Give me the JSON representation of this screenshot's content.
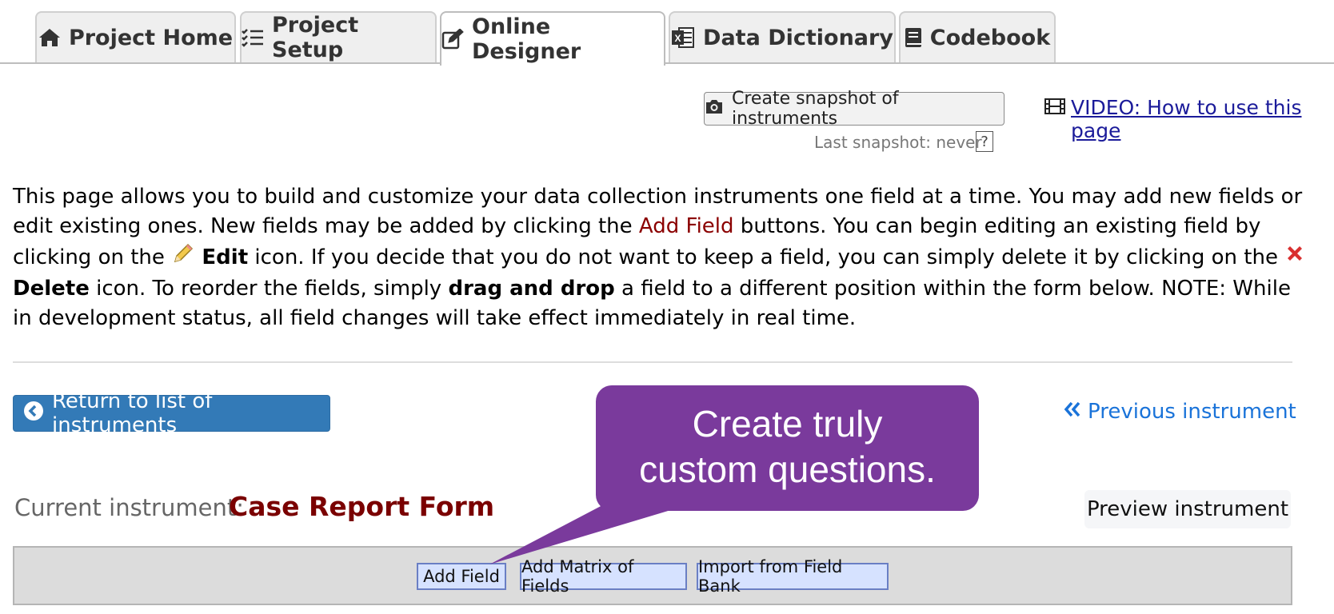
{
  "tabs": [
    {
      "label": "Project Home",
      "icon": "home-icon"
    },
    {
      "label": "Project Setup",
      "icon": "checklist-icon"
    },
    {
      "label": "Online Designer",
      "icon": "edit-icon",
      "active": true
    },
    {
      "label": "Data Dictionary",
      "icon": "excel-icon"
    },
    {
      "label": "Codebook",
      "icon": "book-icon"
    }
  ],
  "snapshot": {
    "button_label": "Create snapshot of instruments",
    "last_snapshot": "Last snapshot: never",
    "help": "?"
  },
  "video_link": "VIDEO: How to use this page",
  "instructions": {
    "p1": "This page allows you to build and customize your data collection instruments one field at a time. You may add new fields or edit existing ones. New fields may be added by clicking the ",
    "add_field": "Add Field",
    "p2": " buttons. You can begin editing an existing field by clicking on the ",
    "edit": "Edit",
    "p3": " icon. If you decide that you do not want to keep a field, you can simply delete it by clicking on the ",
    "delete": "Delete",
    "p4": " icon. To reorder the fields, simply ",
    "drag": "drag and drop",
    "p5": " a field to a different position within the form below. NOTE: While in development status, all field changes will take effect immediately in real time."
  },
  "return_button": "Return to list of instruments",
  "previous_instrument": "Previous instrument",
  "current_instrument": {
    "label": "Current instrument:",
    "name": "Case Report Form"
  },
  "preview_button": "Preview instrument",
  "field_buttons": {
    "add_field": "Add Field",
    "add_matrix": "Add Matrix of Fields",
    "import_bank": "Import from Field Bank"
  },
  "callout": {
    "line1": "Create truly",
    "line2": "custom questions."
  },
  "colors": {
    "callout": "#7a3a9c",
    "return_button": "#337ab7",
    "instrument_name": "#7a0000",
    "link": "#1a73d9"
  }
}
